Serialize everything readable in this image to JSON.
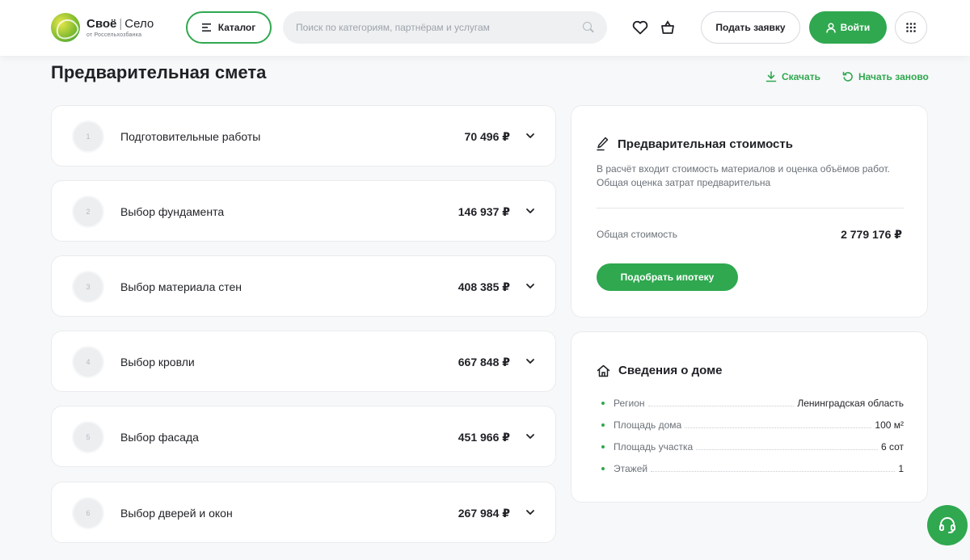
{
  "header": {
    "logo": {
      "title_part1": "Своё",
      "title_part2": "Село",
      "subtitle": "от Россельхозбанка"
    },
    "catalog_label": "Каталог",
    "search_placeholder": "Поиск по категориям, партнёрам и услугам",
    "apply_label": "Подать заявку",
    "login_label": "Войти"
  },
  "page": {
    "title": "Предварительная смета",
    "download_label": "Скачать",
    "restart_label": "Начать заново"
  },
  "steps": [
    {
      "num": "1",
      "title": "Подготовительные работы",
      "price": "70 496 ₽"
    },
    {
      "num": "2",
      "title": "Выбор фундамента",
      "price": "146 937 ₽"
    },
    {
      "num": "3",
      "title": "Выбор материала стен",
      "price": "408 385 ₽"
    },
    {
      "num": "4",
      "title": "Выбор кровли",
      "price": "667 848 ₽"
    },
    {
      "num": "5",
      "title": "Выбор фасада",
      "price": "451 966 ₽"
    },
    {
      "num": "6",
      "title": "Выбор дверей и окон",
      "price": "267 984 ₽"
    }
  ],
  "cost_panel": {
    "title": "Предварительная стоимость",
    "description": "В расчёт входит стоимость материалов и оценка объёмов работ. Общая оценка затрат предварительна",
    "total_label": "Общая стоимость",
    "total_value": "2 779 176 ₽",
    "mortgage_label": "Подобрать ипотеку"
  },
  "house_panel": {
    "title": "Сведения о доме",
    "rows": [
      {
        "label": "Регион",
        "value": "Ленинградская область"
      },
      {
        "label": "Площадь дома",
        "value": "100 м²"
      },
      {
        "label": "Площадь участка",
        "value": "6 сот"
      },
      {
        "label": "Этажей",
        "value": "1"
      }
    ]
  },
  "colors": {
    "accent": "#2fa84f",
    "background": "#f7f8f9",
    "text": "#1f2126",
    "muted": "#6b7178"
  }
}
